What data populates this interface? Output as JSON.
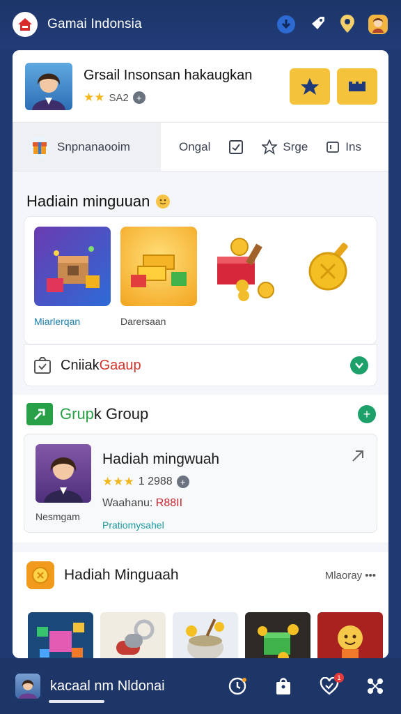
{
  "header": {
    "title": "Gamai Indonsia",
    "icons": [
      "notification-icon",
      "rocket-icon",
      "location-icon",
      "profile-icon"
    ]
  },
  "profile": {
    "name": "Grsail Insonsan hakaugkan",
    "level": "SA2",
    "stars": "★★"
  },
  "tabs": {
    "active": "Snpnanaooim",
    "items": [
      "Ongal",
      "Srge",
      "Ins"
    ]
  },
  "rewards": {
    "title": "Hadiain minguuan",
    "items": [
      {
        "caption": "Miarlerqan",
        "caption_color": "#1a7fb0"
      },
      {
        "caption": "Darersaan",
        "caption_color": "#444444"
      },
      {
        "caption": ""
      },
      {
        "caption": ""
      }
    ]
  },
  "group_row": {
    "label_part1": "Cniiak",
    "label_part2": "Gaaup"
  },
  "group2": {
    "label_part1": "Grup",
    "label_part2": "k Group",
    "member": {
      "name": "Hadiah mingwuah",
      "stars": "★★★",
      "count": "1 2988",
      "status_prefix": "Waahanu:",
      "status_value": "R88II",
      "foot_left": "Nesmgam",
      "foot_right": "Pratiomysahel"
    }
  },
  "weekly": {
    "title": "Hadiah Minguaah",
    "more": "Mlaoray •••"
  },
  "bottom": {
    "label": "kacaal nm Nldonai",
    "badge": "1"
  }
}
